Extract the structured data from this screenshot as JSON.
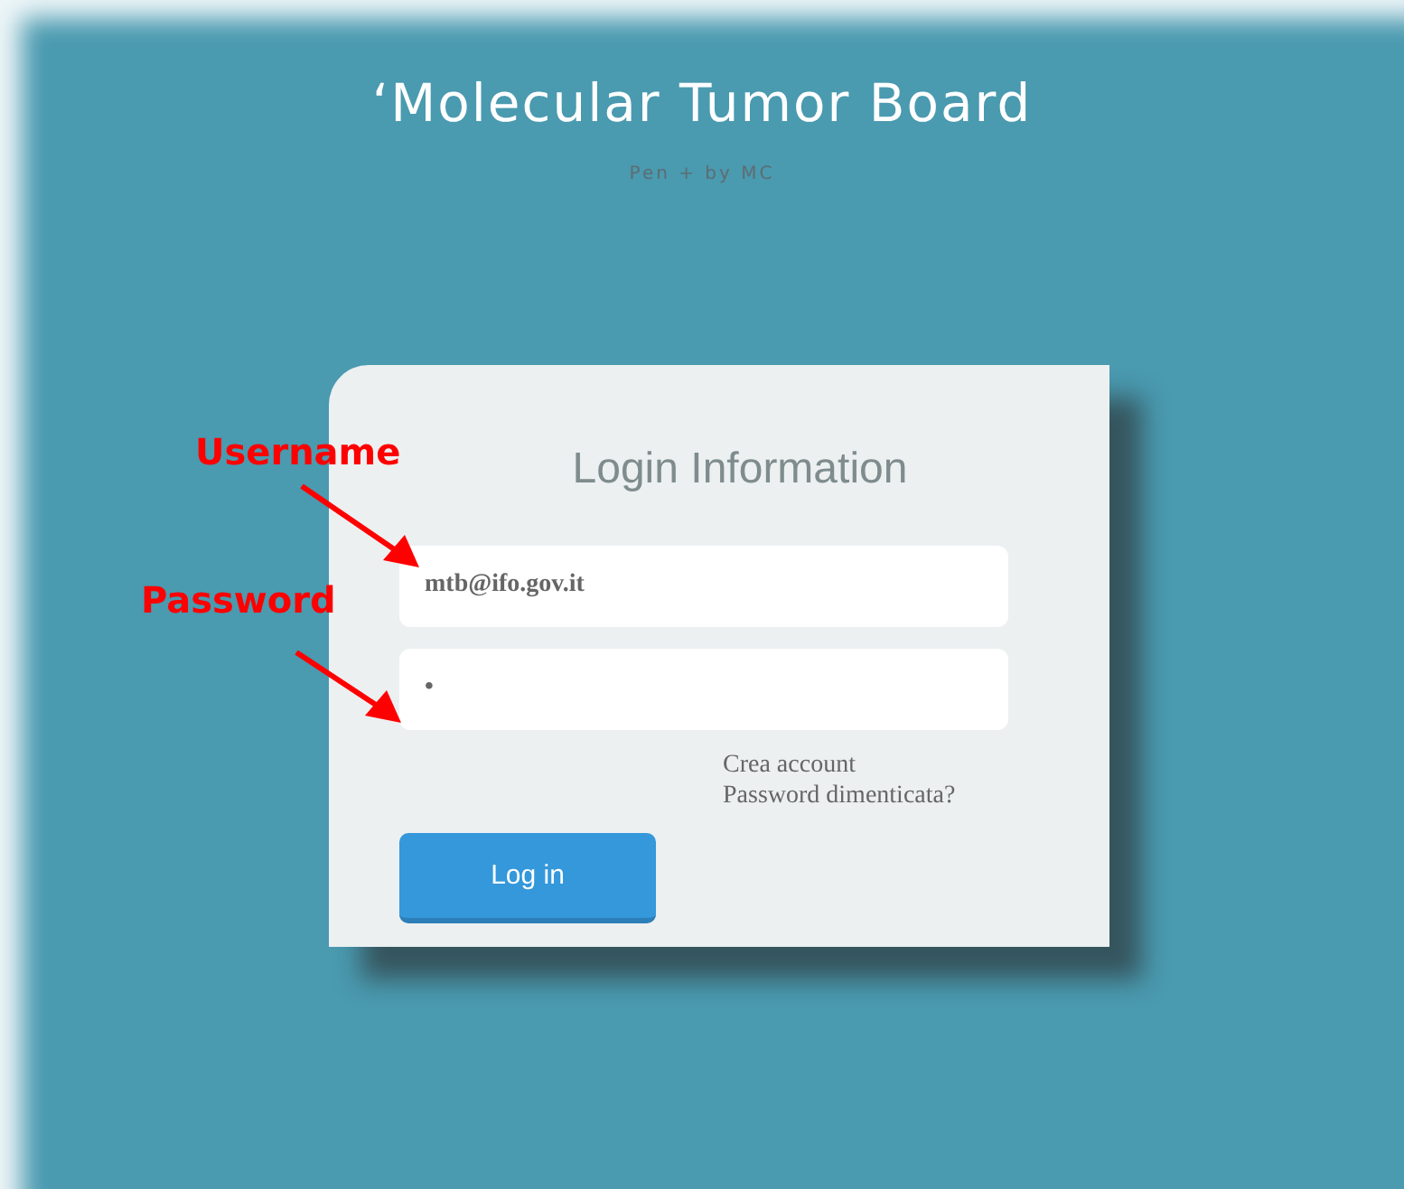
{
  "header": {
    "title": "‘Molecular Tumor Board",
    "subtitle": "Pen + by MC"
  },
  "login_card": {
    "heading": "Login Information",
    "username": {
      "value": "mtb@ifo.gov.it"
    },
    "password": {
      "value": "•"
    },
    "links": [
      "Crea account",
      "Password dimenticata?"
    ],
    "button": "Log in"
  },
  "annotations": [
    {
      "label": "Username"
    },
    {
      "label": "Password"
    }
  ]
}
